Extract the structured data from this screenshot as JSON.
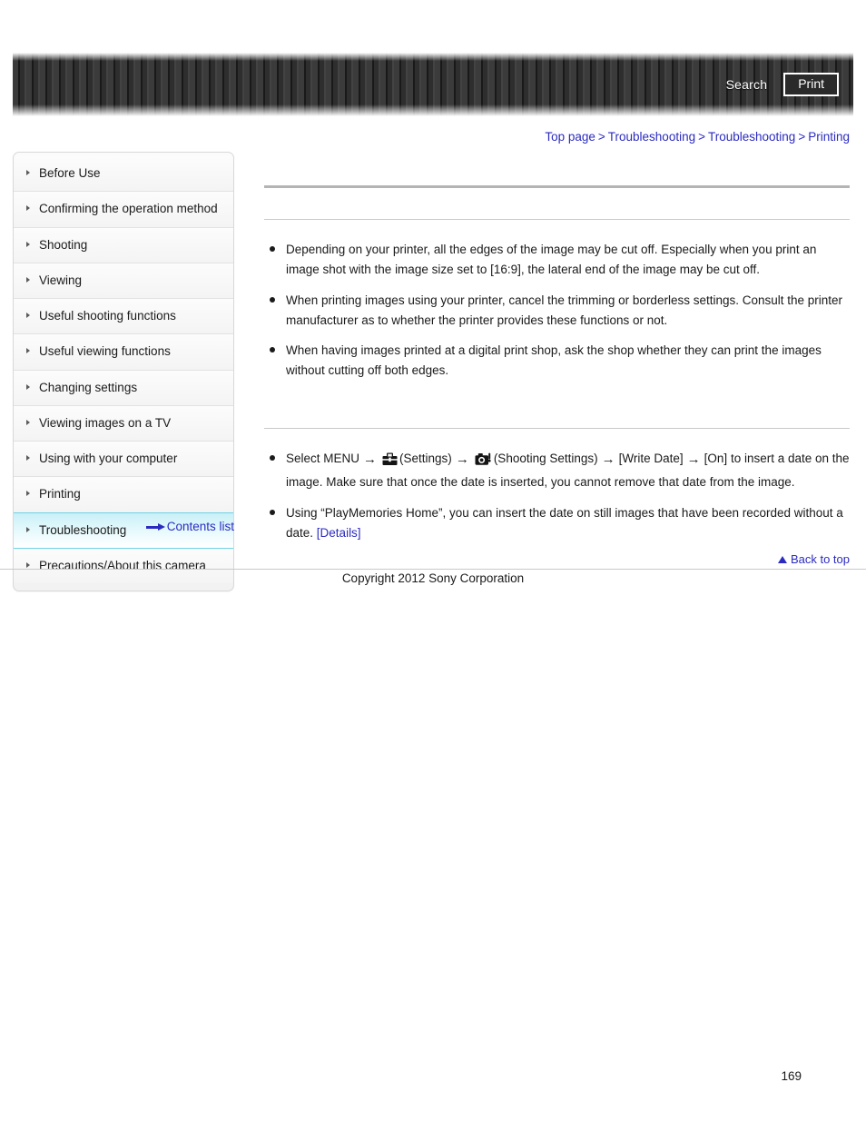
{
  "header": {
    "search_label": "Search",
    "print_label": "Print"
  },
  "breadcrumb": {
    "separator": ">",
    "items": [
      {
        "label": "Top page"
      },
      {
        "label": "Troubleshooting"
      },
      {
        "label": "Troubleshooting"
      },
      {
        "label": "Printing"
      }
    ]
  },
  "sidebar": {
    "items": [
      {
        "label": "Before Use",
        "active": false
      },
      {
        "label": "Confirming the operation method",
        "active": false
      },
      {
        "label": "Shooting",
        "active": false
      },
      {
        "label": "Viewing",
        "active": false
      },
      {
        "label": "Useful shooting functions",
        "active": false
      },
      {
        "label": "Useful viewing functions",
        "active": false
      },
      {
        "label": "Changing settings",
        "active": false
      },
      {
        "label": "Viewing images on a TV",
        "active": false
      },
      {
        "label": "Using with your computer",
        "active": false
      },
      {
        "label": "Printing",
        "active": false
      },
      {
        "label": "Troubleshooting",
        "active": true
      },
      {
        "label": "Precautions/About this camera",
        "active": false
      }
    ],
    "contents_list_label": "Contents list"
  },
  "main": {
    "page_title": "",
    "section1_heading": "",
    "section1_bullets": [
      "Depending on your printer, all the edges of the image may be cut off. Especially when you print an image shot with the image size set to [16:9], the lateral end of the image may be cut off.",
      "When printing images using your printer, cancel the trimming or borderless settings. Consult the printer manufacturer as to whether the printer provides these functions or not.",
      "When having images printed at a digital print shop, ask the shop whether they can print the images without cutting off both edges."
    ],
    "section2_heading": "",
    "menu_bullet": {
      "part1": "Select MENU",
      "arrow": "→",
      "settings_label": "(Settings)",
      "shooting_settings_label": "(Shooting Settings)",
      "write_date_label": "[Write Date]",
      "on_label": "[On]",
      "tail": "to insert a date on the image. Make sure that once the date is inserted, you cannot remove that date from the image."
    },
    "playmemories_bullet": {
      "text": "Using “PlayMemories Home”, you can insert the date on still images that have been recorded without a date.",
      "link_label": "[Details]"
    }
  },
  "footer": {
    "back_to_top_label": "Back to top",
    "copyright": "Copyright 2012 Sony Corporation",
    "page_number": "169"
  },
  "colors": {
    "link": "#2b2bc0",
    "active_nav": "#c8f0f7",
    "rule": "#c9c9c9"
  }
}
